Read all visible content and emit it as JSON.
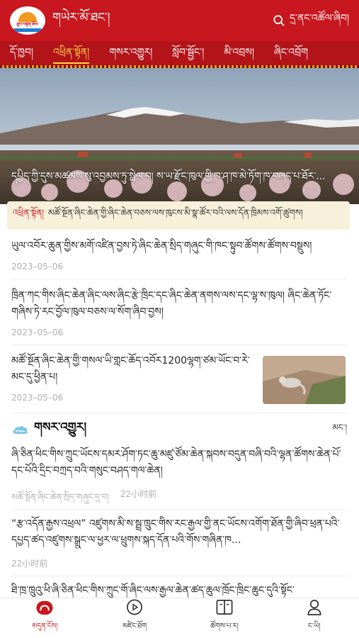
{
  "header": {
    "logo_text": "ཐུབ་བསྟན་ཆོས་",
    "title": "གཡེར་མོ་ཐང་།",
    "search_label": "དྲ་ནང་འཚོལ་ཞིབ།"
  },
  "category_nav": [
    {
      "label": "དོ་ཁྱབ།",
      "active": false
    },
    {
      "label": "འཕྲིན་སྟོན།",
      "active": true
    },
    {
      "label": "གསར་འགྱུར།",
      "active": false
    },
    {
      "label": "སློབ་སྦྱོང་།",
      "active": false
    },
    {
      "label": "མི་འབྲས།",
      "active": false
    },
    {
      "label": "ཞིང་འབྲོག",
      "active": false
    }
  ],
  "hero": {
    "caption": "དཔྱིད་ཀྱི་དུས་མཚམས་སུ་འབྱམས་ཏུ་སྤེལ་བ། ས་ཡ་རྫོང་ཁུལ་གྱི་ཁ་ཤ་ཁ་མེ་ཏོག་ཁ་བཞད་པ་ཐོར་..."
  },
  "notice": {
    "tag": "འཕྲིན་སྟོན།",
    "text": "མཚོ་སྔོན་ཞིང་ཆེན་གྱི་ཞིང་ཆེན་བཅས་ལས་ཁུངས་མི་སྣ་ཚོར་བའི་ལས་དོན་ཁྲིམས་འགོ་ཚུགས།"
  },
  "news": [
    {
      "title": "ཡུལ་འབོར་ཆུན་གྱིས་མགོ་འཛིན་བྱས་ཏེ་ཞིང་ཆེན་སྲིད་གཞུང་གི་ཁང་སྟུབ་ཚོགས་ཚོགས་བསྡུས།",
      "date": "2023–05–06"
    },
    {
      "title": "ཁྲིན་ཀང་གིས་ཞིང་ཆེན་ཞིང་ལས་ཞིང་རྩེ་ཁྲིང་དང་ཞིང་ཆེན་ནགས་ལས་དང་ལྷ་ས་ཁུལ། ཞིང་ཆེན་ཏོང་གཞིས་ཏེ་རང་བྱོལ་ཁུལ་བཅས་ལ་སོག་ཞིབ་བྱས།",
      "date": "2023–05–06"
    },
    {
      "title": "མཚོ་སྔོན་ཞིང་ཆེན་གྱི་གསལ་ཡི་གླང་ཆོད་འབོར1200ལྷག་ཙམ་ཡོང་བ་རེ་མང་དུ་ཕྱིན་པ།",
      "date": "2023–05–06"
    }
  ],
  "section": {
    "title": "གསར་འགྱུར།",
    "more_label": "མང་།"
  },
  "section_news": [
    {
      "title": "ཞི་ཅིན་ཕིང་གིས་ཀྲུང་ཡོངས་དམར་ཤོག་ཏང་ཆུ་མཛུ་ཙོམ་ཆེན་སྐབས་བདུན་བཞི་བའི་ལྷན་ཚོགས་ཆེན་པོ་དང་པོའི་དྲིང་བཀྲད་བའི་གསུང་བཤད་གལ་ཆེན།",
      "source": "མཚོ་སྔོན་ཞིང་ཆེན་སྲིད་གཞུང་དྲ་བ།",
      "time": "22小时前"
    },
    {
      "title": "“རྩ་འདོན་རྒྱས་འཕྲལ” འཛུགས་མི་ས་སྦྲ་ཁྲུང་གིས་རང་རྒྱལ་གྱི་ནང་ཡོངས་འགོག་ཐོན་གྱི་ཞིབ་ཕྲན་པའི་དཔྱད་ཚད་འཛུགས་སྒྲུང་ལ་ཕྱར་ལ་ཕྲུགས་སྐད་དོན་པའི་གོས་གཞིན་ཁ...",
      "source": "",
      "time": "22小时前"
    },
    {
      "title": "ཐི་ཁྲ་ཁྲུའུ་ཕི་ཞི་ཅིན་ཕིང་གིས་ཀྲུང་གོ་ཞིང་ལས་རྒྱལ་ཆེན་ཚད་ཆུལ་ཁྲོང་ཁྲིང་ཆུང་དུའི་སྟོང་",
      "source": "",
      "time": ""
    }
  ],
  "tabbar": [
    {
      "label": "མདུན་ངོས།",
      "icon": "home-icon",
      "active": true
    },
    {
      "label": "མཛིང་ཐོག",
      "icon": "video-icon",
      "active": false
    },
    {
      "label": "ཚོགས་པ་ར།",
      "icon": "book-icon",
      "active": false
    },
    {
      "label": "ང་ཡི།",
      "icon": "user-icon",
      "active": false
    }
  ],
  "colors": {
    "brand_red": "#c8171e",
    "nav_red": "#b3141a",
    "active_yellow": "#ffd24a",
    "notice_bg": "#f7f0da"
  }
}
